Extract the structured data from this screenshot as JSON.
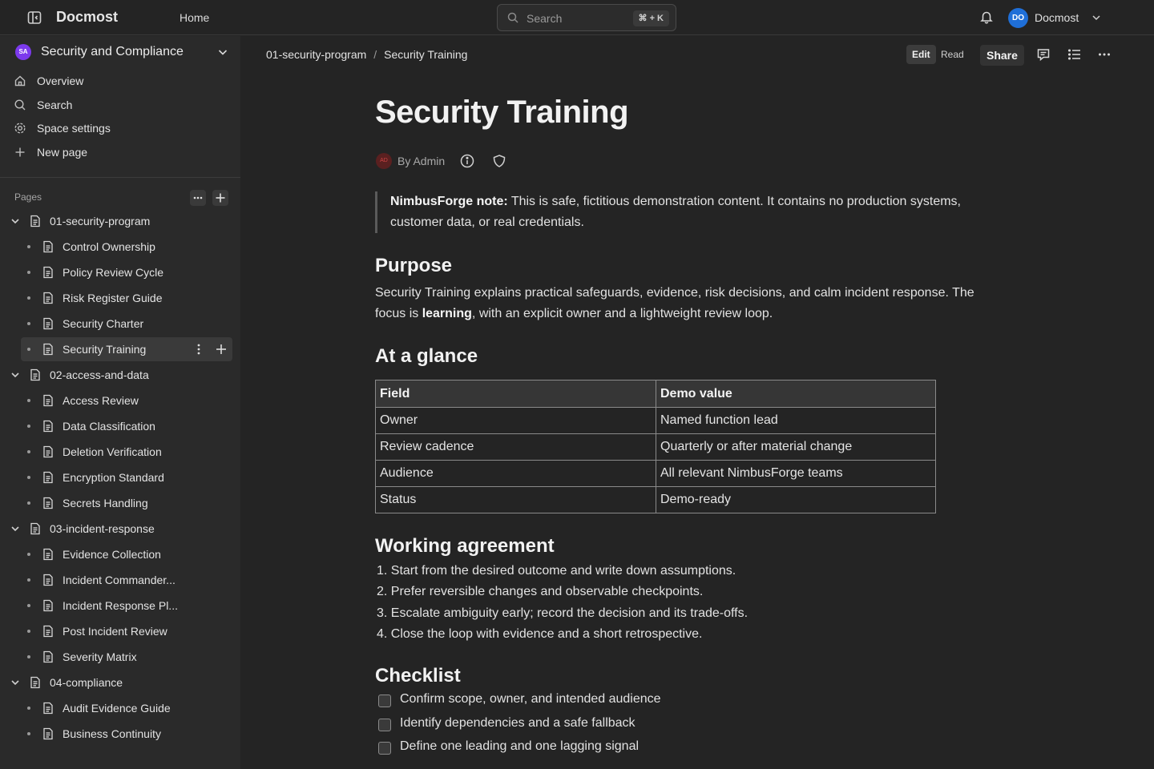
{
  "header": {
    "app_name": "Docmost",
    "home_label": "Home",
    "search_placeholder": "Search",
    "search_shortcut": "⌘ + K",
    "user_initials": "DO",
    "user_name": "Docmost"
  },
  "sidebar": {
    "space_initials": "SA",
    "space_name": "Security and Compliance",
    "nav": [
      {
        "label": "Overview",
        "icon": "home-icon"
      },
      {
        "label": "Search",
        "icon": "search-icon"
      },
      {
        "label": "Space settings",
        "icon": "gear-icon"
      },
      {
        "label": "New page",
        "icon": "plus-icon"
      }
    ],
    "pages_label": "Pages",
    "tree": [
      {
        "label": "01-security-program",
        "level": 0
      },
      {
        "label": "Control Ownership",
        "level": 1
      },
      {
        "label": "Policy Review Cycle",
        "level": 1
      },
      {
        "label": "Risk Register Guide",
        "level": 1
      },
      {
        "label": "Security Charter",
        "level": 1
      },
      {
        "label": "Security Training",
        "level": 1,
        "active": true
      },
      {
        "label": "02-access-and-data",
        "level": 0
      },
      {
        "label": "Access Review",
        "level": 1
      },
      {
        "label": "Data Classification",
        "level": 1
      },
      {
        "label": "Deletion Verification",
        "level": 1
      },
      {
        "label": "Encryption Standard",
        "level": 1
      },
      {
        "label": "Secrets Handling",
        "level": 1
      },
      {
        "label": "03-incident-response",
        "level": 0
      },
      {
        "label": "Evidence Collection",
        "level": 1
      },
      {
        "label": "Incident Commander...",
        "level": 1
      },
      {
        "label": "Incident Response Pl...",
        "level": 1
      },
      {
        "label": "Post Incident Review",
        "level": 1
      },
      {
        "label": "Severity Matrix",
        "level": 1
      },
      {
        "label": "04-compliance",
        "level": 0
      },
      {
        "label": "Audit Evidence Guide",
        "level": 1
      },
      {
        "label": "Business Continuity",
        "level": 1
      }
    ]
  },
  "toolbar": {
    "breadcrumb": [
      "01-security-program",
      "Security Training"
    ],
    "breadcrumb_separator": "/",
    "edit_label": "Edit",
    "read_label": "Read",
    "share_label": "Share"
  },
  "doc": {
    "title": "Security Training",
    "author_initials": "AD",
    "byline": "By Admin",
    "callout_bold": "NimbusForge note:",
    "callout_text": " This is safe, fictitious demonstration content. It contains no production systems, customer data, or real credentials.",
    "purpose_heading": "Purpose",
    "purpose_text_1": "Security Training explains practical safeguards, evidence, risk decisions, and calm incident response. The focus is ",
    "purpose_bold": "learning",
    "purpose_text_2": ", with an explicit owner and a lightweight review loop.",
    "glance_heading": "At a glance",
    "table": {
      "headers": [
        "Field",
        "Demo value"
      ],
      "rows": [
        [
          "Owner",
          "Named function lead"
        ],
        [
          "Review cadence",
          "Quarterly or after material change"
        ],
        [
          "Audience",
          "All relevant NimbusForge teams"
        ],
        [
          "Status",
          "Demo-ready"
        ]
      ]
    },
    "working_heading": "Working agreement",
    "working_items": [
      "1. Start from the desired outcome and write down assumptions.",
      "2. Prefer reversible changes and observable checkpoints.",
      "3. Escalate ambiguity early; record the decision and its trade-offs.",
      "4. Close the loop with evidence and a short retrospective."
    ],
    "checklist_heading": "Checklist",
    "checklist_items": [
      "Confirm scope, owner, and intended audience",
      "Identify dependencies and a safe fallback",
      "Define one leading and one lagging signal"
    ]
  }
}
